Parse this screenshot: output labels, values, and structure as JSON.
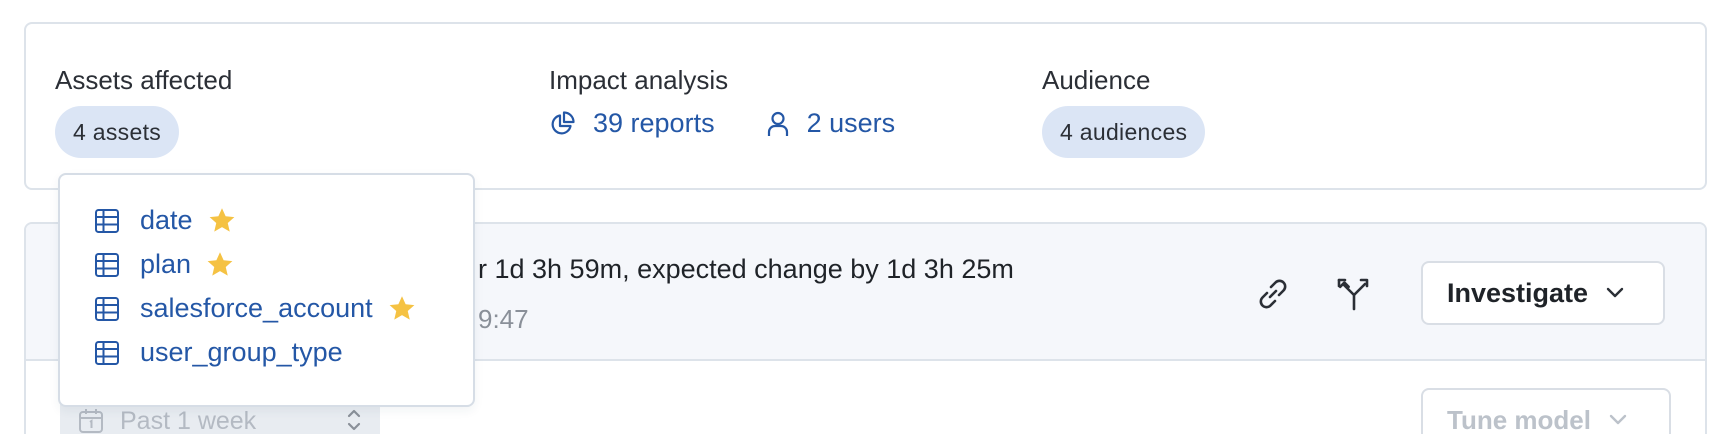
{
  "summary": {
    "assets": {
      "title": "Assets affected",
      "pill": "4 assets"
    },
    "impact": {
      "title": "Impact analysis",
      "reports": "39 reports",
      "users": "2 users"
    },
    "audience": {
      "title": "Audience",
      "pill": "4 audiences"
    }
  },
  "incident": {
    "title": "r 1d 3h 59m, expected change by 1d 3h 25m",
    "time": "9:47",
    "investigate_label": "Investigate",
    "range_label": "Past 1 week",
    "tune_label": "Tune model"
  },
  "assets_popover": {
    "items": [
      {
        "name": "date",
        "starred": true
      },
      {
        "name": "plan",
        "starred": true
      },
      {
        "name": "salesforce_account",
        "starred": true
      },
      {
        "name": "user_group_type",
        "starred": false
      }
    ]
  },
  "colors": {
    "link": "#2457a6",
    "pill_bg": "#dbe5f5",
    "star": "#f5c243",
    "border": "#dde3ea",
    "header_bg": "#f5f7fb"
  },
  "icons": {
    "reports": "pie-chart-icon",
    "users": "user-icon",
    "link": "link-icon",
    "lineage": "branch-icon",
    "chevron": "chevron-down-icon",
    "table": "table-icon",
    "star": "star-icon",
    "calendar": "calendar-icon",
    "updown": "sort-arrows-icon"
  }
}
